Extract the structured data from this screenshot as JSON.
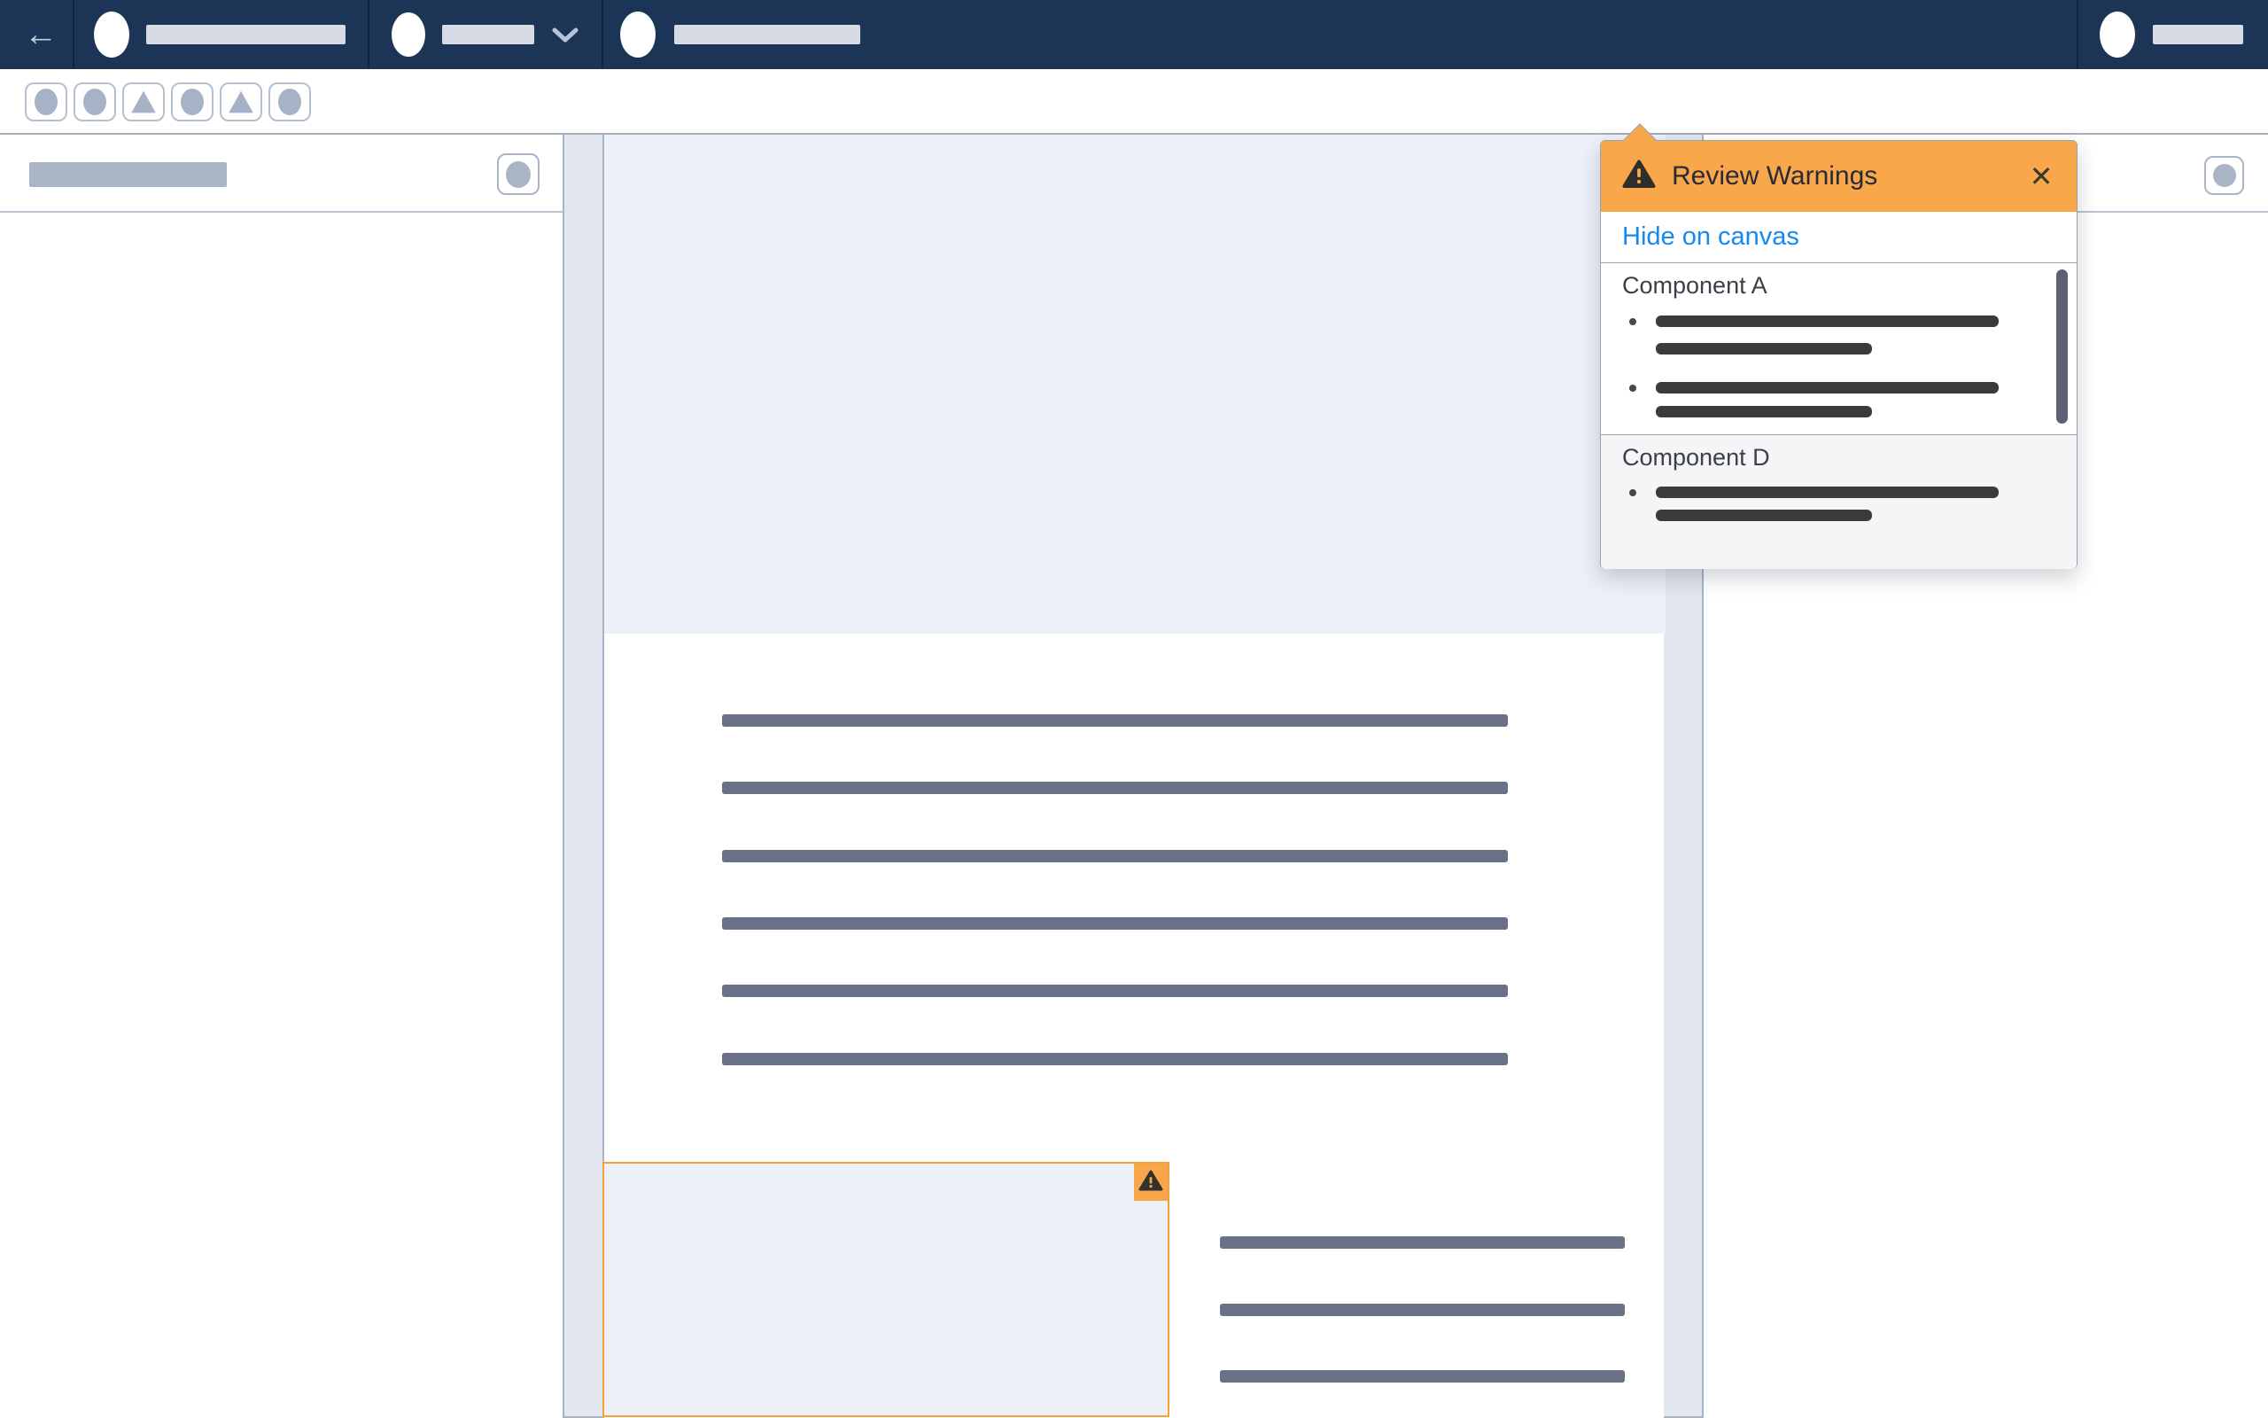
{
  "icons": {
    "back": "←",
    "close": "✕",
    "chevron_down": "chevron-down",
    "warning": "warning-triangle"
  },
  "colors": {
    "header_navy": "#1c3455",
    "primary_blue": "#0176d3",
    "warning_orange": "#f8a84b",
    "warning_border": "#f2a23b",
    "link_blue": "#1589ee",
    "redacted_slate": "#6a7086",
    "canvas_gray": "#e2e6ef",
    "hero_gray": "#ecf0f8"
  },
  "header": {
    "back_icon": "arrow-left",
    "nav_groups": [
      {
        "avatar": true,
        "label_redacted": true
      },
      {
        "avatar": true,
        "label_redacted": true,
        "chevron": true
      },
      {
        "avatar": true,
        "label_redacted": true
      }
    ],
    "user": {
      "avatar": true,
      "label_redacted": true
    }
  },
  "toolbar": {
    "icon_shapes": [
      "circle",
      "circle",
      "triangle",
      "circle",
      "triangle",
      "circle"
    ],
    "page_label_redacted": true,
    "warning_icon": "warning-triangle",
    "segmented_buttons": 2,
    "outline_button_redacted": true,
    "primary_button_redacted": true
  },
  "sidebar_left": {
    "title_redacted": true,
    "icon_button": "circle"
  },
  "sidebar_right": {
    "icon_button": "circle"
  },
  "canvas": {
    "hero_block": true,
    "main_text_lines": 6,
    "side_text_lines": 3,
    "warning_component": {
      "flagged": true,
      "badge_icon": "warning-triangle"
    }
  },
  "popover": {
    "title": "Review Warnings",
    "title_icon": "warning-triangle",
    "close_icon": "✕",
    "link_label": "Hide on canvas",
    "sections": [
      {
        "title": "Component A",
        "bullets": [
          {
            "lines": [
              "long",
              "short"
            ]
          },
          {
            "lines": [
              "long",
              "short"
            ]
          }
        ],
        "scrollbar": true
      },
      {
        "title": "Component D",
        "bullets": [
          {
            "lines": [
              "long",
              "short"
            ]
          }
        ]
      }
    ]
  }
}
